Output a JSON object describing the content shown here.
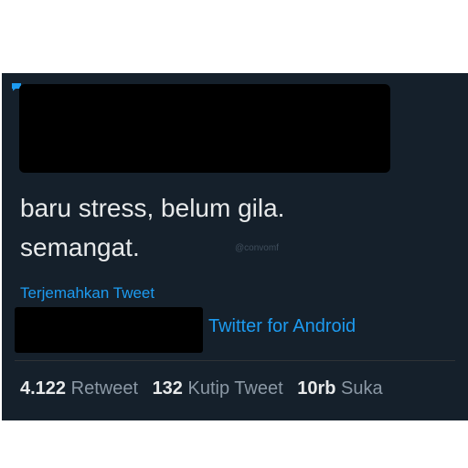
{
  "tweet": {
    "text_lines": [
      "baru stress, belum gila.",
      "semangat."
    ],
    "watermark": "@convomf",
    "translate_label": "Terjemahkan Tweet",
    "source": "Twitter for Android"
  },
  "stats": {
    "retweets": {
      "count": "4.122",
      "label": "Retweet"
    },
    "quotes": {
      "count": "132",
      "label": "Kutip Tweet"
    },
    "likes": {
      "count": "10rb",
      "label": "Suka"
    }
  },
  "colors": {
    "background": "#15202b",
    "text": "#e7e9ea",
    "accent": "#1d9bf0",
    "muted": "#8b98a5",
    "redaction": "#000000"
  },
  "icons": {
    "corner": "speech-bubble-icon"
  }
}
